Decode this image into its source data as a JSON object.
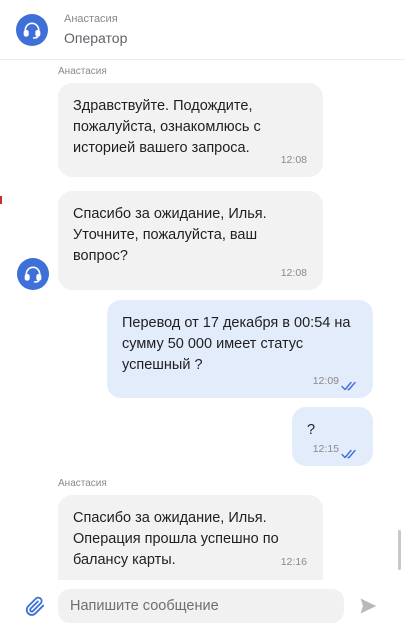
{
  "header": {
    "name": "Анастасия",
    "role": "Оператор"
  },
  "messages": [
    {
      "direction": "in",
      "sender": "Анастасия",
      "text": "Здравствуйте. Подождите, пожалуйста, ознакомлюсь с историей вашего запроса.",
      "time": "12:08"
    },
    {
      "direction": "in",
      "text": "Спасибо за ожидание, Илья. Уточните, пожалуйста, ваш вопрос?",
      "time": "12:08"
    },
    {
      "direction": "out",
      "text": "Перевод от 17 декабря в 00:54 на сумму 50 000 имеет статус успешный ?",
      "time": "12:09",
      "status": "read"
    },
    {
      "direction": "out",
      "text": "?",
      "time": "12:15",
      "status": "read"
    },
    {
      "direction": "in",
      "sender": "Анастасия",
      "text": "Спасибо за ожидание, Илья. Операция прошла успешно по балансу карты.",
      "time": "12:16"
    }
  ],
  "composer": {
    "placeholder": "Напишите сообщение"
  },
  "icons": {
    "avatar": "headset-icon",
    "attach": "paperclip-icon",
    "send": "send-icon",
    "read_status": "double-check-icon"
  },
  "colors": {
    "accent": "#3f6fd8",
    "incoming_bubble": "#f2f2f2",
    "outgoing_bubble": "#e3ecfb"
  }
}
